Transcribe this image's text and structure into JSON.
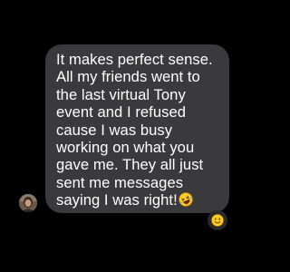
{
  "message": {
    "lines": [
      "It makes perfect sense.",
      "All my friends went to",
      "the last virtual Tony",
      "event and I refused",
      "cause I was busy",
      "working on what you",
      "gave me. They all just",
      "sent me messages",
      "saying I was right!"
    ],
    "trailing_emoji": "rolling-on-the-floor-laughing-emoji",
    "bubble_color": "#3a3a3c",
    "text_color": "#ffffff"
  },
  "sender": {
    "avatar": "sender-avatar-photo"
  },
  "reaction": {
    "emoji": "smiling-face-emoji"
  },
  "background_color": "#000000"
}
